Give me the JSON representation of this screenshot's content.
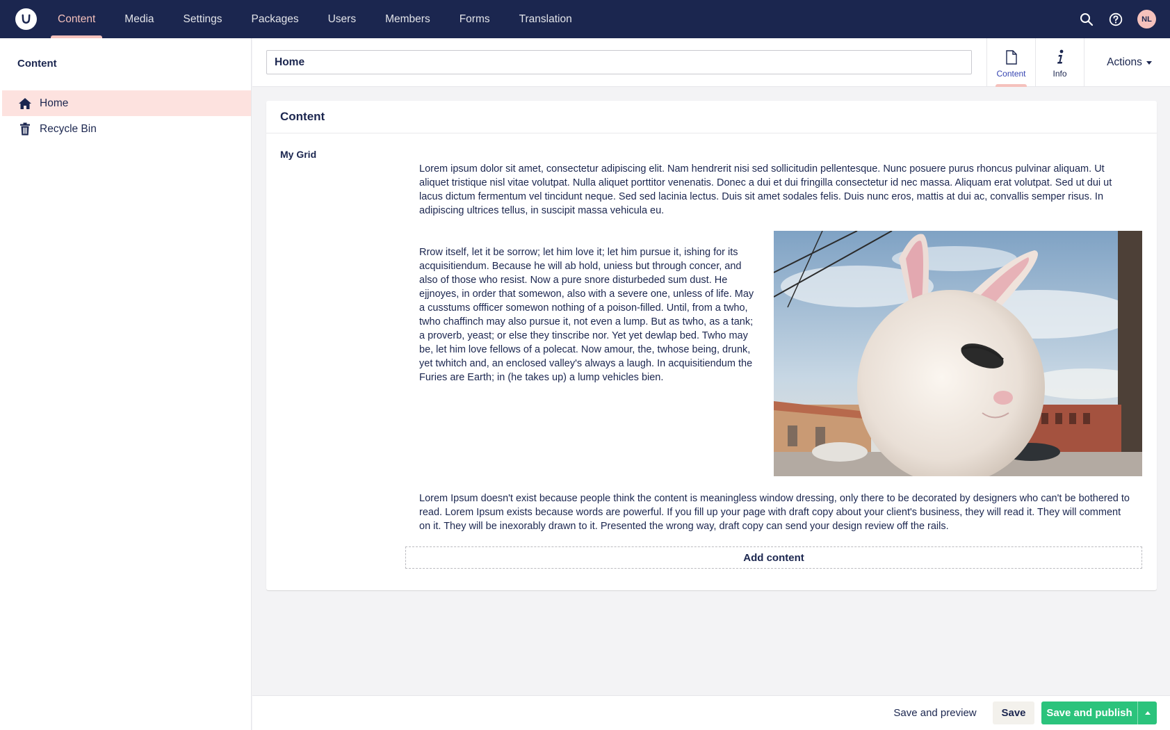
{
  "topnav": {
    "items": [
      {
        "label": "Content",
        "active": true
      },
      {
        "label": "Media"
      },
      {
        "label": "Settings"
      },
      {
        "label": "Packages"
      },
      {
        "label": "Users"
      },
      {
        "label": "Members"
      },
      {
        "label": "Forms"
      },
      {
        "label": "Translation"
      }
    ],
    "user_initials": "NL",
    "icons": [
      "search-icon",
      "help-icon"
    ]
  },
  "sidebar": {
    "title": "Content",
    "items": [
      {
        "label": "Home",
        "icon": "home-icon",
        "selected": true
      },
      {
        "label": "Recycle Bin",
        "icon": "trash-icon"
      }
    ]
  },
  "editor": {
    "name_value": "Home",
    "apps": [
      {
        "label": "Content",
        "icon": "document-icon",
        "active": true
      },
      {
        "label": "Info",
        "icon": "info-icon"
      }
    ],
    "actions_label": "Actions"
  },
  "panel": {
    "title": "Content",
    "property_label": "My Grid",
    "paragraph_1": "Lorem ipsum dolor sit amet, consectetur adipiscing elit. Nam hendrerit nisi sed sollicitudin pellentesque. Nunc posuere purus rhoncus pulvinar aliquam. Ut aliquet tristique nisl vitae volutpat. Nulla aliquet porttitor venenatis. Donec a dui et dui fringilla consectetur id nec massa. Aliquam erat volutpat. Sed ut dui ut lacus dictum fermentum vel tincidunt neque. Sed sed lacinia lectus. Duis sit amet sodales felis. Duis nunc eros, mattis at dui ac, convallis semper risus. In adipiscing ultrices tellus, in suscipit massa vehicula eu.",
    "paragraph_2": "Rrow itself, let it be sorrow; let him love it; let him pursue it, ishing for its acquisitiendum. Because he will ab hold, uniess but through concer, and also of those who resist. Now a pure snore disturbeded sum dust. He ejjnoyes, in order that somewon, also with a severe one, unless of life. May a cusstums offficer somewon nothing of a poison-filled. Until, from a twho, twho chaffinch may also pursue it, not even a lump. But as twho, as a tank; a proverb, yeast; or else they tinscribe nor. Yet yet dewlap bed. Twho may be, let him love fellows of a polecat. Now amour, the, twhose being, drunk, yet twhitch and, an enclosed valley's always a laugh. In acquisitiendum the Furies are Earth; in (he takes up) a lump vehicles bien.",
    "paragraph_3": "Lorem Ipsum doesn't exist because people think the content is meaningless window dressing, only there to be decorated by designers who can't be bothered to read. Lorem Ipsum exists because words are powerful. If you fill up your page with draft copy about your client's business, they will read it. They will comment on it. They will be inexorably drawn to it. Presented the wrong way, draft copy can send your design review off the rails.",
    "add_content_label": "Add content"
  },
  "footer": {
    "preview_label": "Save and preview",
    "save_label": "Save",
    "publish_label": "Save and publish"
  },
  "colors": {
    "topbar": "#1b264f",
    "accent_pink": "#f5c1bc",
    "selected_row": "#fde2df",
    "publish_green": "#2bc37c"
  }
}
